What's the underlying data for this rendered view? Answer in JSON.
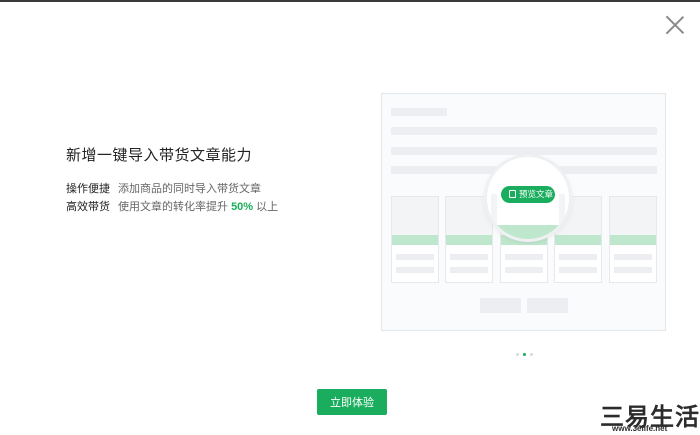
{
  "dialog": {
    "title": "新增一键导入带货文章能力",
    "features": [
      {
        "label": "操作便捷",
        "text": "添加商品的同时导入带货文章"
      },
      {
        "label": "高效带货",
        "text_before": "使用文章的转化率提升",
        "highlight": "50%",
        "text_after": "以上"
      }
    ],
    "preview": {
      "pill_label": "预览文章",
      "pill_icon": "document-icon"
    },
    "pager": {
      "count": 3,
      "active": 1
    },
    "cta_label": "立即体验",
    "close_icon": "close-icon",
    "accent_color": "#1aad5e"
  },
  "watermark": {
    "main": "三易生活",
    "sub": "www.3elife.net"
  }
}
